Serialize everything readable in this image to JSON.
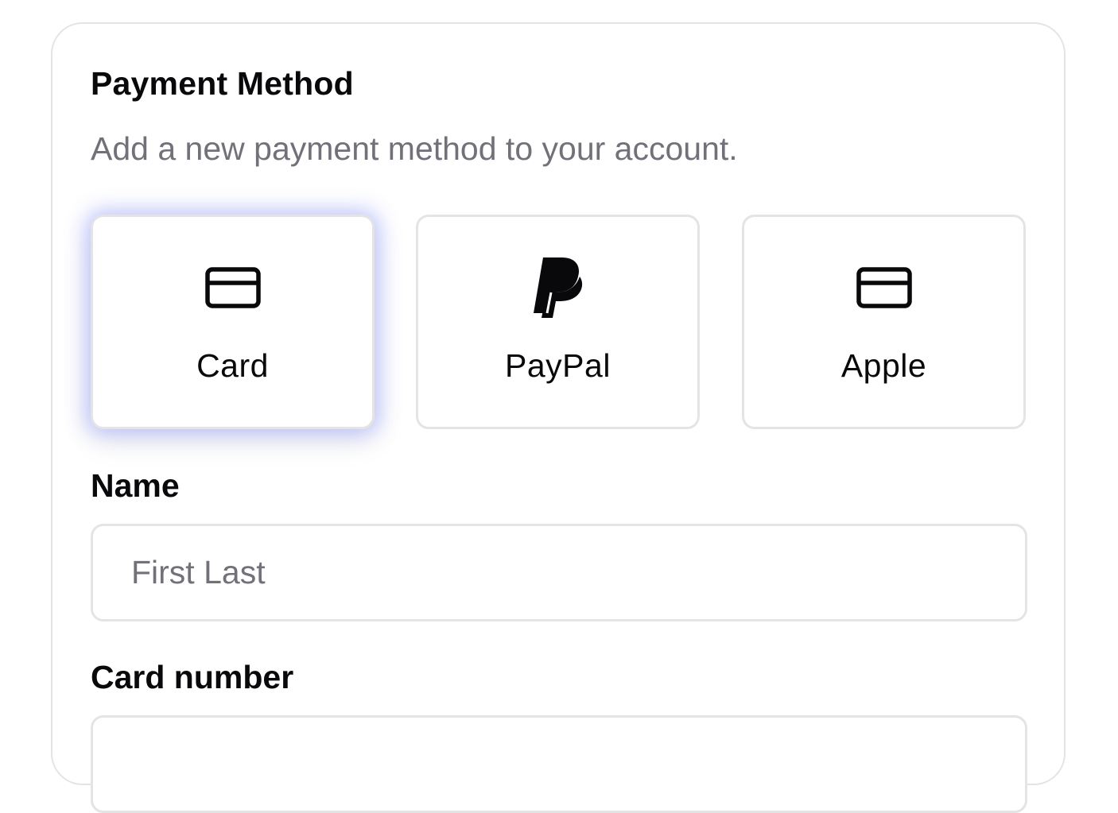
{
  "header": {
    "title": "Payment Method",
    "subtitle": "Add a new payment method to your account."
  },
  "methods": [
    {
      "label": "Card",
      "icon": "credit-card-icon",
      "selected": true
    },
    {
      "label": "PayPal",
      "icon": "paypal-icon",
      "selected": false
    },
    {
      "label": "Apple",
      "icon": "credit-card-icon",
      "selected": false
    }
  ],
  "form": {
    "name_label": "Name",
    "name_value": "",
    "name_placeholder": "First Last",
    "card_number_label": "Card number",
    "card_number_value": ""
  },
  "colors": {
    "border": "#e4e4e7",
    "muted_text": "#71717a",
    "selected_glow": "#7884ff"
  }
}
